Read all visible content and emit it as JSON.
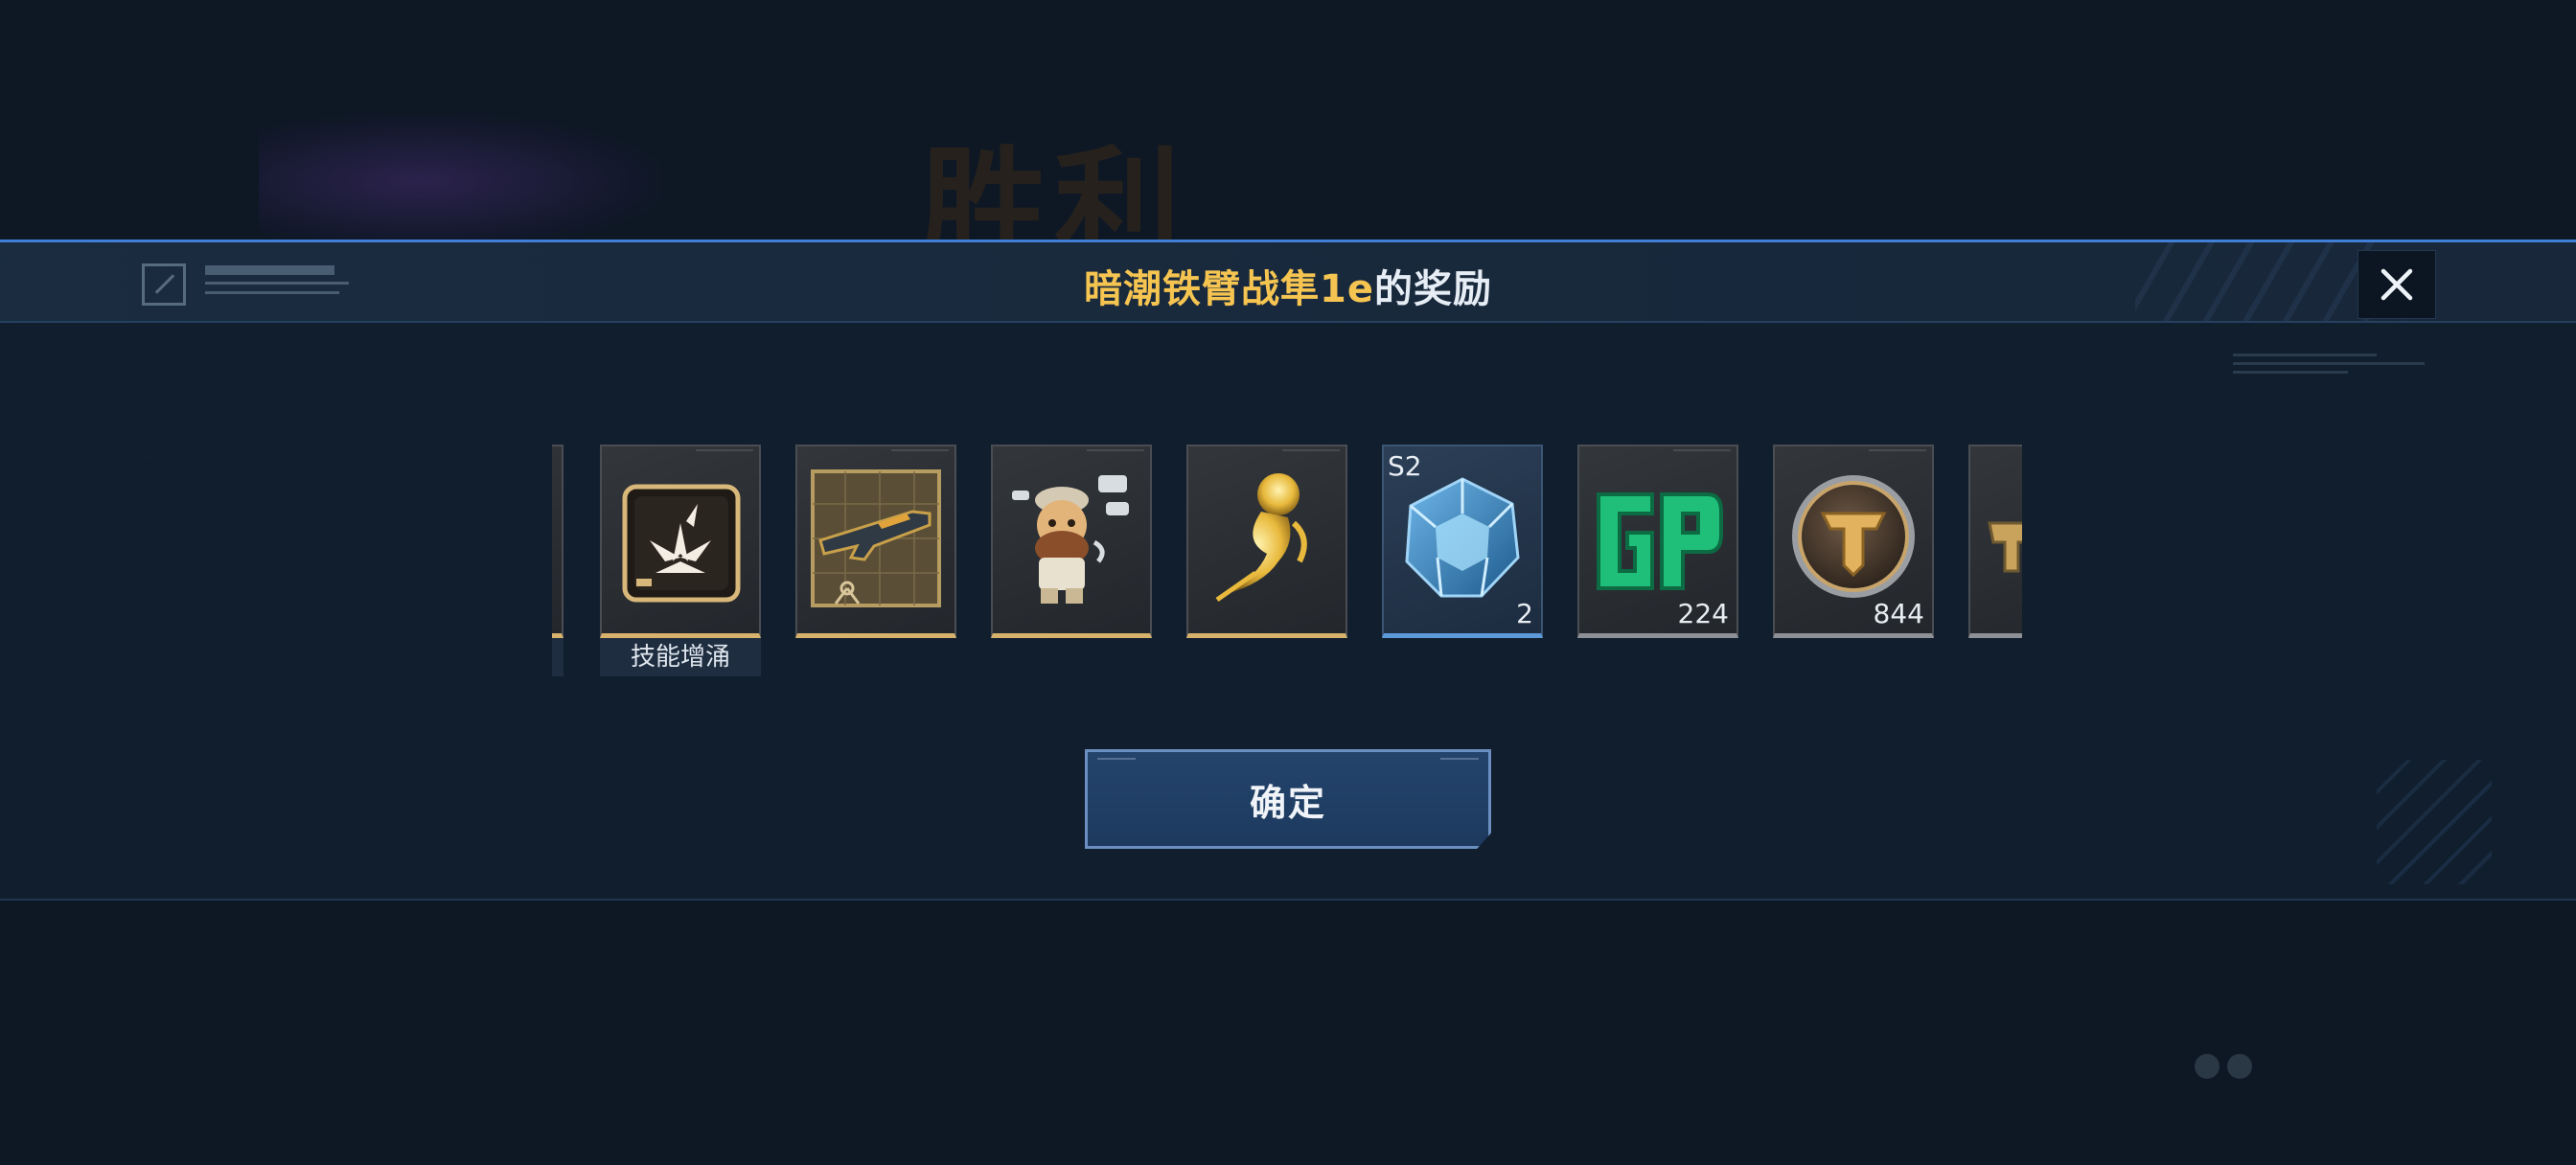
{
  "background": {
    "victory_text": "胜利"
  },
  "modal": {
    "title_highlight": "暗潮铁臂战隼1e",
    "title_suffix": "的奖励",
    "close_icon": "close-icon",
    "confirm_label": "确定"
  },
  "rewards": [
    {
      "name": "reward-partial-left",
      "icon": "partial-card",
      "frame": "gold"
    },
    {
      "name": "reward-skill-surge",
      "icon": "skill-surge-icon",
      "frame": "gold",
      "label": "技能增涌"
    },
    {
      "name": "reward-weapon-blueprint",
      "icon": "weapon-blueprint-icon",
      "frame": "gold"
    },
    {
      "name": "reward-character-figure",
      "icon": "character-figure-icon",
      "frame": "gold"
    },
    {
      "name": "reward-golden-spirit",
      "icon": "golden-spirit-icon",
      "frame": "gold"
    },
    {
      "name": "reward-s2-cube",
      "icon": "crystal-cube-icon",
      "frame": "blue",
      "badge": "S2",
      "quantity": "2"
    },
    {
      "name": "reward-gp",
      "icon": "gp-icon",
      "frame": "gray",
      "quantity": "224"
    },
    {
      "name": "reward-medal",
      "icon": "bronze-medal-icon",
      "frame": "gray",
      "quantity": "844"
    },
    {
      "name": "reward-partial-right",
      "icon": "partial-card",
      "frame": "gray"
    }
  ]
}
